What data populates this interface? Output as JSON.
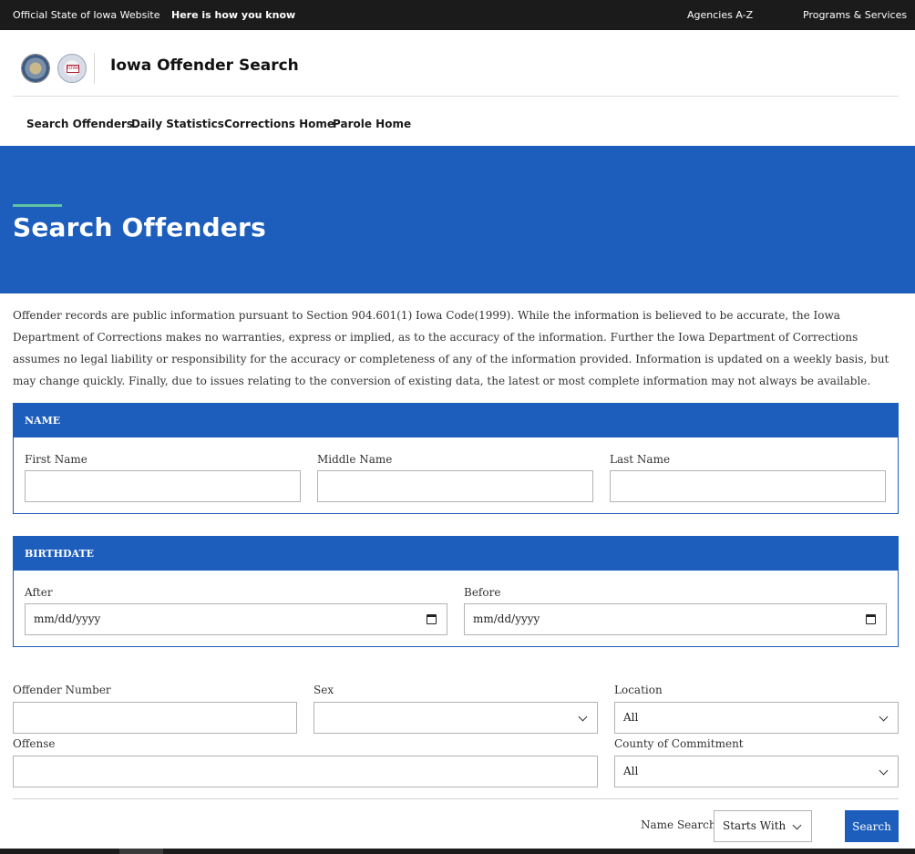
{
  "topbar": {
    "official": "Official State of Iowa Website",
    "how_you_know": "Here is how you know",
    "agencies": "Agencies A-Z",
    "programs": "Programs & Services"
  },
  "header": {
    "title": "Iowa Offender Search",
    "seal_text": "IOWA"
  },
  "nav": {
    "items": [
      "Search Offenders",
      "Daily Statistics",
      "Corrections Home",
      "Parole Home"
    ]
  },
  "hero": {
    "title": "Search Offenders"
  },
  "intro": {
    "text": "Offender records are public information pursuant to Section 904.601(1) Iowa Code(1999). While the information is believed to be accurate, the Iowa Department of Corrections makes no warranties, express or implied, as to the accuracy of the information. Further the Iowa Department of Corrections assumes no legal liability or responsibility for the accuracy or completeness of any of the information provided. Information is updated on a weekly basis, but may change quickly. Finally, due to issues relating to the conversion of existing data, the latest or most complete information may not always be available."
  },
  "name_panel": {
    "heading": "NAME",
    "first_label": "First Name",
    "middle_label": "Middle Name",
    "last_label": "Last Name"
  },
  "birthdate_panel": {
    "heading": "BIRTHDATE",
    "after_label": "After",
    "before_label": "Before",
    "after_value": "mm/dd/yyyy",
    "before_value": "mm/dd/yyyy"
  },
  "filters": {
    "offender_number_label": "Offender Number",
    "sex_label": "Sex",
    "sex_value": "",
    "location_label": "Location",
    "location_value": "All",
    "offense_label": "Offense",
    "county_label": "County of Commitment",
    "county_value": "All"
  },
  "actions": {
    "name_search_label": "Name Search",
    "name_search_value": "Starts With",
    "search_button": "Search"
  }
}
